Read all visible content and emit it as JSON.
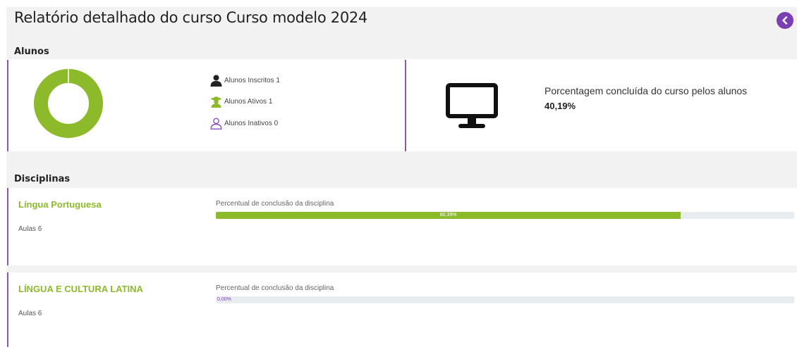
{
  "header": {
    "title": "Relatório detalhado do curso Curso modelo 2024"
  },
  "alunos": {
    "section_label": "Alunos",
    "completion_fraction": 1.0,
    "stats": [
      {
        "icon": "person-icon",
        "label": "Alunos Inscritos 1"
      },
      {
        "icon": "graduate-icon",
        "label": "Alunos Ativos 1"
      },
      {
        "icon": "person-outline-icon",
        "label": "Alunos Inativos 0"
      }
    ],
    "course_pct_label": "Porcentagem concluída do curso pelos alunos",
    "course_pct_value": "40,19%"
  },
  "disciplinas": {
    "section_label": "Disciplinas",
    "items": [
      {
        "name": "Língua Portuguesa",
        "aulas": "Aulas 6",
        "bar_label": "Percentual de conclusão da disciplina",
        "percent_text": "80,39%",
        "percent": 80.39
      },
      {
        "name": "LÍNGUA E CULTURA LATINA",
        "aulas": "Aulas 6",
        "bar_label": "Percentual de conclusão da disciplina",
        "percent_text": "0,00%",
        "percent": 0
      }
    ]
  },
  "colors": {
    "accent": "#8dba2a",
    "purple": "#7b3fb3",
    "band": "#f2f2f2"
  }
}
